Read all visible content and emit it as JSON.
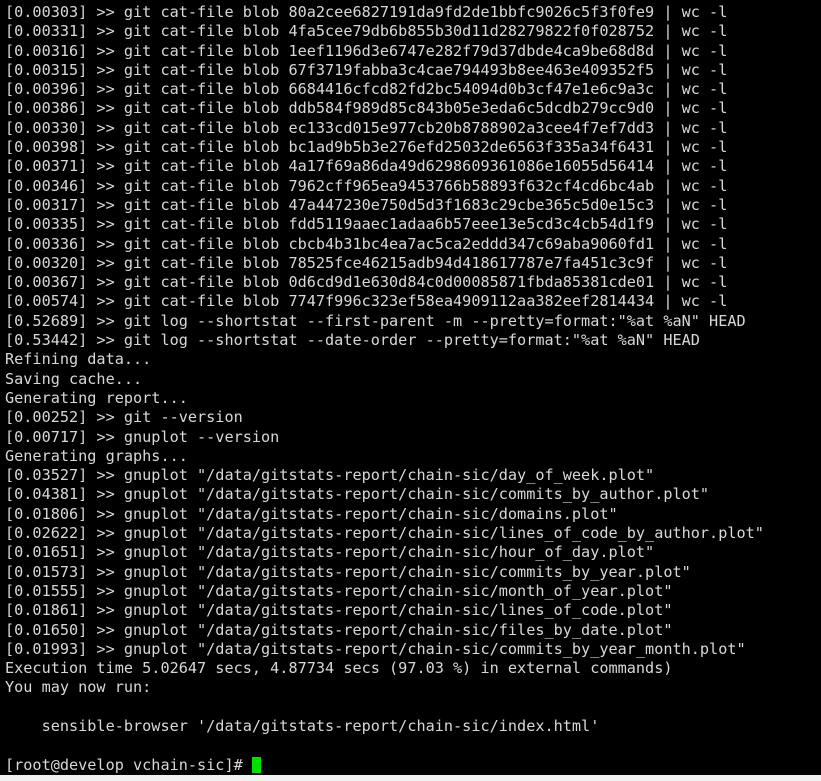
{
  "terminal": {
    "background_color": "#000000",
    "text_color": "#d8d8d8",
    "cursor_color": "#00e000",
    "bottom_strip_color": "#f0f0f0",
    "lines": [
      "[0.00303] >> git cat-file blob 80a2cee6827191da9fd2de1bbfc9026c5f3f0fe9 | wc -l",
      "[0.00331] >> git cat-file blob 4fa5cee79db6b855b30d11d28279822f0f028752 | wc -l",
      "[0.00316] >> git cat-file blob 1eef1196d3e6747e282f79d37dbde4ca9be68d8d | wc -l",
      "[0.00315] >> git cat-file blob 67f3719fabba3c4cae794493b8ee463e409352f5 | wc -l",
      "[0.00396] >> git cat-file blob 6684416cfcd82fd2bc54094d0b3cf47e1e6c9a3c | wc -l",
      "[0.00386] >> git cat-file blob ddb584f989d85c843b05e3eda6c5dcdb279cc9d0 | wc -l",
      "[0.00330] >> git cat-file blob ec133cd015e977cb20b8788902a3cee4f7ef7dd3 | wc -l",
      "[0.00398] >> git cat-file blob bc1ad9b5b3e276efd25032de6563f335a34f6431 | wc -l",
      "[0.00371] >> git cat-file blob 4a17f69a86da49d6298609361086e16055d56414 | wc -l",
      "[0.00346] >> git cat-file blob 7962cff965ea9453766b58893f632cf4cd6bc4ab | wc -l",
      "[0.00317] >> git cat-file blob 47a447230e750d5d3f1683c29cbe365c5d0e15c3 | wc -l",
      "[0.00335] >> git cat-file blob fdd5119aaec1adaa6b57eee13e5cd3c4cb54d1f9 | wc -l",
      "[0.00336] >> git cat-file blob cbcb4b31bc4ea7ac5ca2eddd347c69aba9060fd1 | wc -l",
      "[0.00320] >> git cat-file blob 78525fce46215adb94d418617787e7fa451c3c9f | wc -l",
      "[0.00367] >> git cat-file blob 0d6cd9d1e630d84c0d00085871fbda85381cde01 | wc -l",
      "[0.00574] >> git cat-file blob 7747f996c323ef58ea4909112aa382eef2814434 | wc -l",
      "[0.52689] >> git log --shortstat --first-parent -m --pretty=format:\"%at %aN\" HEAD",
      "[0.53442] >> git log --shortstat --date-order --pretty=format:\"%at %aN\" HEAD",
      "Refining data...",
      "Saving cache...",
      "Generating report...",
      "[0.00252] >> git --version",
      "[0.00717] >> gnuplot --version",
      "Generating graphs...",
      "[0.03527] >> gnuplot \"/data/gitstats-report/chain-sic/day_of_week.plot\"",
      "[0.04381] >> gnuplot \"/data/gitstats-report/chain-sic/commits_by_author.plot\"",
      "[0.01806] >> gnuplot \"/data/gitstats-report/chain-sic/domains.plot\"",
      "[0.02622] >> gnuplot \"/data/gitstats-report/chain-sic/lines_of_code_by_author.plot\"",
      "[0.01651] >> gnuplot \"/data/gitstats-report/chain-sic/hour_of_day.plot\"",
      "[0.01573] >> gnuplot \"/data/gitstats-report/chain-sic/commits_by_year.plot\"",
      "[0.01555] >> gnuplot \"/data/gitstats-report/chain-sic/month_of_year.plot\"",
      "[0.01861] >> gnuplot \"/data/gitstats-report/chain-sic/lines_of_code.plot\"",
      "[0.01650] >> gnuplot \"/data/gitstats-report/chain-sic/files_by_date.plot\"",
      "[0.01993] >> gnuplot \"/data/gitstats-report/chain-sic/commits_by_year_month.plot\"",
      "Execution time 5.02647 secs, 4.87734 secs (97.03 %) in external commands)",
      "You may now run:",
      "",
      "    sensible-browser '/data/gitstats-report/chain-sic/index.html'",
      ""
    ],
    "prompt": "[root@develop vchain-sic]# "
  }
}
